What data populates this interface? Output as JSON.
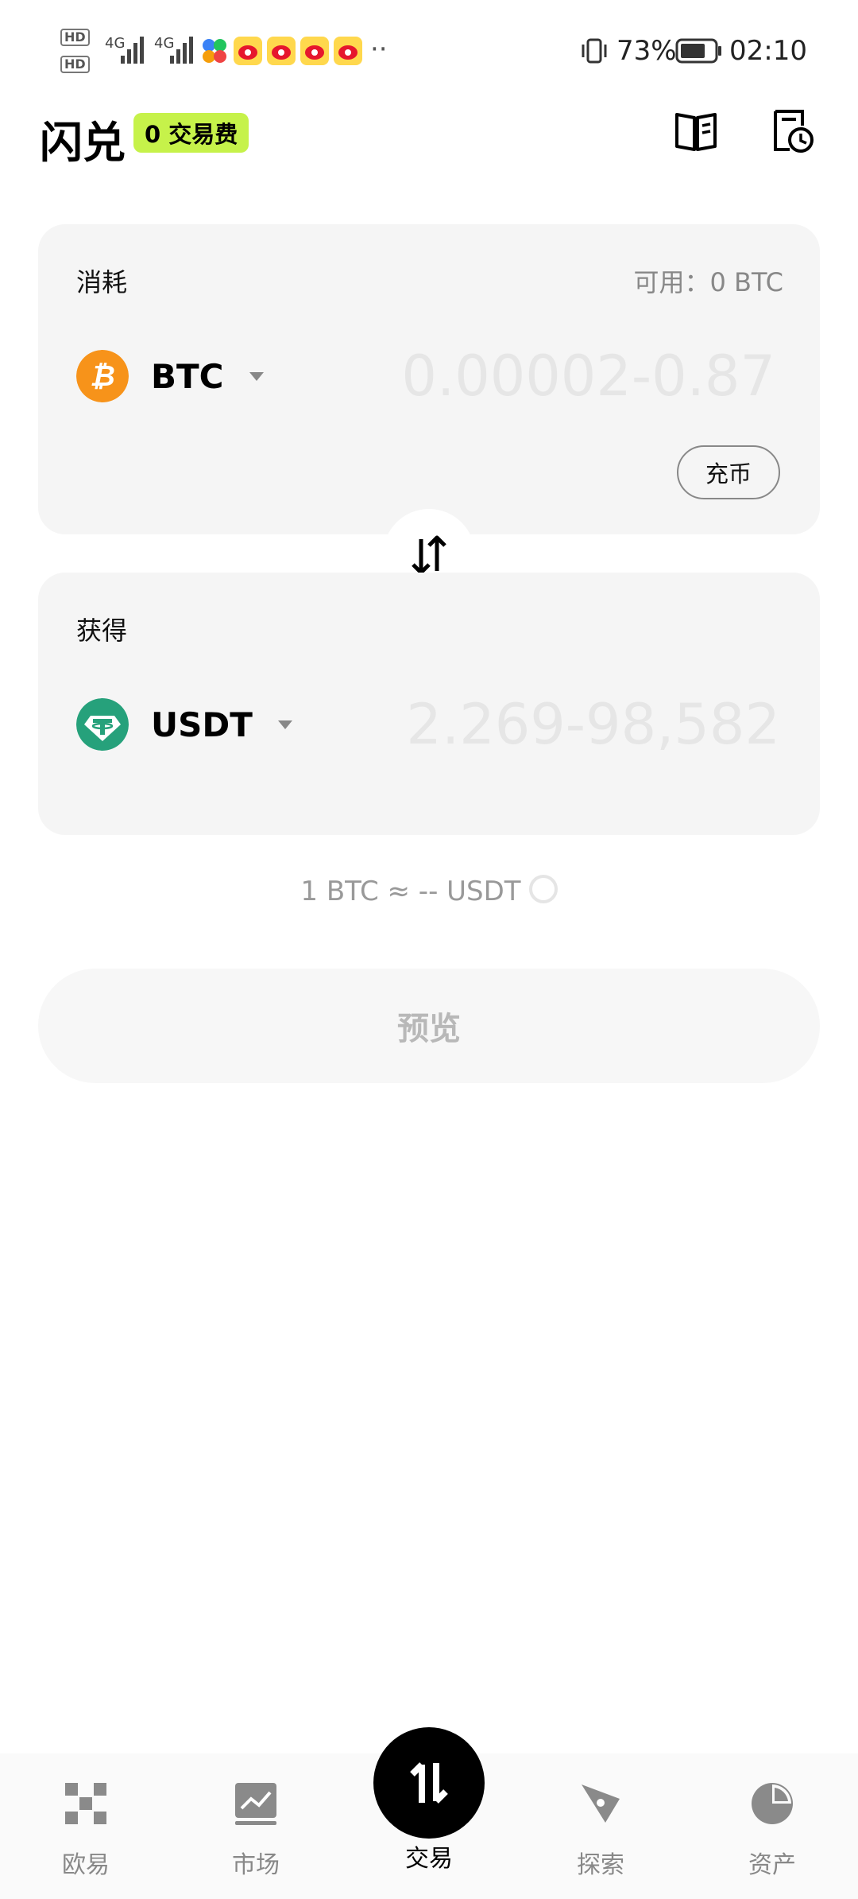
{
  "status_bar": {
    "hd1": "HD",
    "hd2": "HD",
    "sig1": "4G",
    "sig2": "4G",
    "more": "··",
    "battery": "73%",
    "time": "02:10"
  },
  "header": {
    "title": "闪兑",
    "badge": "0 交易费",
    "icons": [
      "book-icon",
      "history-icon"
    ]
  },
  "consume": {
    "label": "消耗",
    "available": "可用：0 BTC",
    "coin": "BTC",
    "amount_placeholder": "0.00002-0.87",
    "deposit_label": "充币"
  },
  "receive": {
    "label": "获得",
    "coin": "USDT",
    "amount_placeholder": "2.269-98,582"
  },
  "rate_text": "1 BTC ≈ -- USDT",
  "preview_label": "预览",
  "nav": {
    "items": [
      {
        "label": "欧易",
        "icon": "okx-logo-icon"
      },
      {
        "label": "市场",
        "icon": "market-chart-icon"
      },
      {
        "label": "交易",
        "icon": "trade-swap-icon"
      },
      {
        "label": "探索",
        "icon": "compass-icon"
      },
      {
        "label": "资产",
        "icon": "pie-chart-icon"
      }
    ]
  },
  "colors": {
    "accent_badge": "#c6f24a",
    "btc": "#f7931a",
    "usdt": "#26a17b",
    "card_bg": "#f5f5f5"
  }
}
